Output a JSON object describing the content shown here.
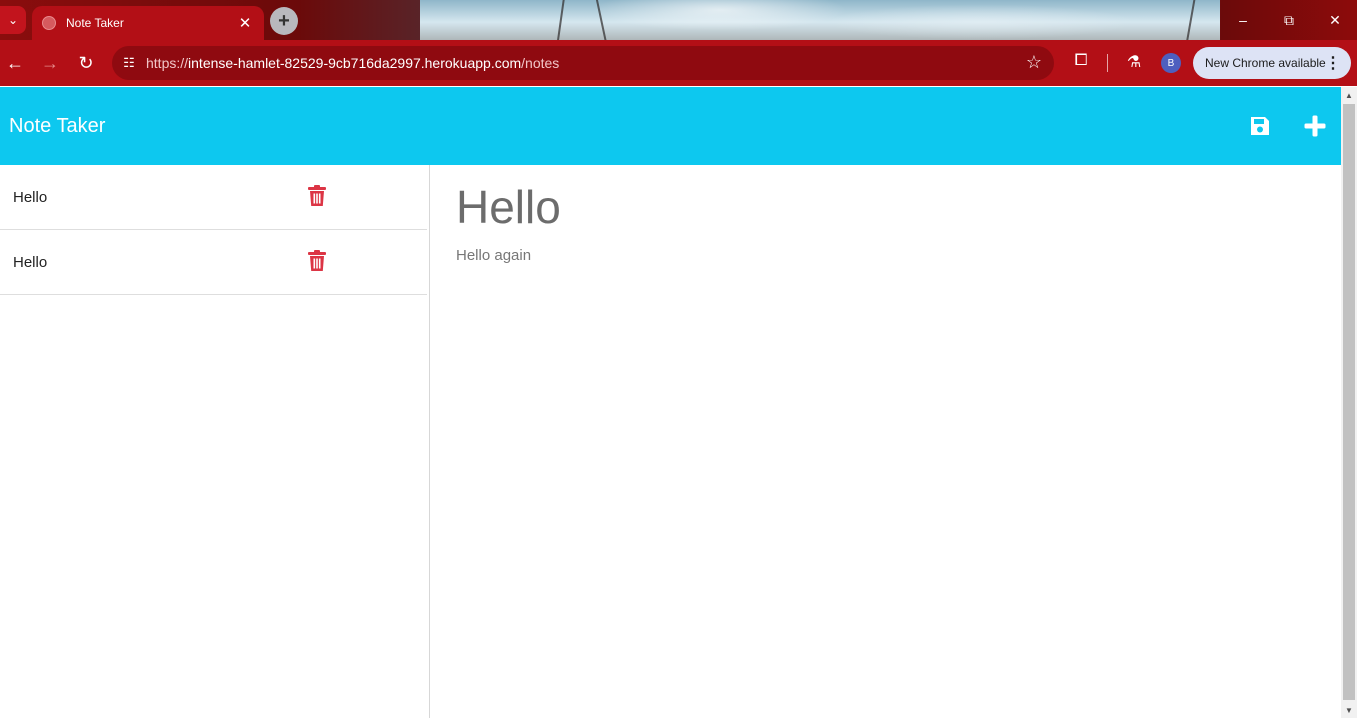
{
  "browser": {
    "tab_title": "Note Taker",
    "url_scheme": "https://",
    "url_host": "intense-hamlet-82529-9cb716da2997.herokuapp.com",
    "url_path": "/notes",
    "profile_initial": "B",
    "update_label": "New Chrome available",
    "accent_color": "#b30f16"
  },
  "app": {
    "brand": "Note Taker",
    "navbar_color": "#0dc8ef",
    "delete_color": "#dc3545"
  },
  "notes": [
    {
      "title": "Hello"
    },
    {
      "title": "Hello"
    }
  ],
  "active_note": {
    "title": "Hello",
    "text": "Hello again"
  }
}
